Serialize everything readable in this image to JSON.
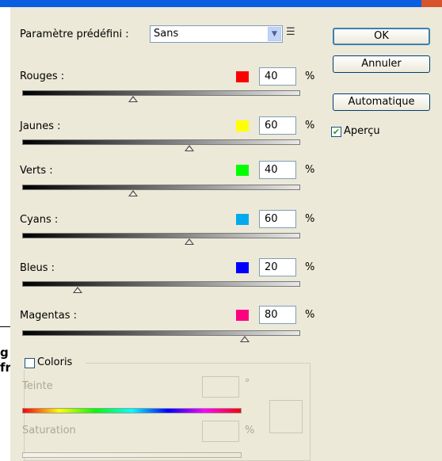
{
  "preset": {
    "label": "Paramètre prédéfini :",
    "value": "Sans"
  },
  "buttons": {
    "ok": "OK",
    "cancel": "Annuler",
    "auto": "Automatique"
  },
  "preview": {
    "label": "Aperçu",
    "checked": true
  },
  "channels": [
    {
      "label": "Rouges :",
      "value": "40",
      "color": "#ff0000",
      "level": 40
    },
    {
      "label": "Jaunes :",
      "value": "60",
      "color": "#ffff00",
      "level": 60
    },
    {
      "label": "Verts :",
      "value": "40",
      "color": "#00ff00",
      "level": 40
    },
    {
      "label": "Cyans :",
      "value": "60",
      "color": "#00aaee",
      "level": 60
    },
    {
      "label": "Bleus :",
      "value": "20",
      "color": "#0000ff",
      "level": 20
    },
    {
      "label": "Magentas :",
      "value": "80",
      "color": "#ff0080",
      "level": 80
    }
  ],
  "percent": "%",
  "tint": {
    "label": "Coloris",
    "checked": false,
    "hue_label": "Teinte",
    "degree": "°",
    "saturation_label": "Saturation",
    "sat_unit": "%"
  },
  "background": {
    "fragment1": "g",
    "fragment2": "fr"
  }
}
